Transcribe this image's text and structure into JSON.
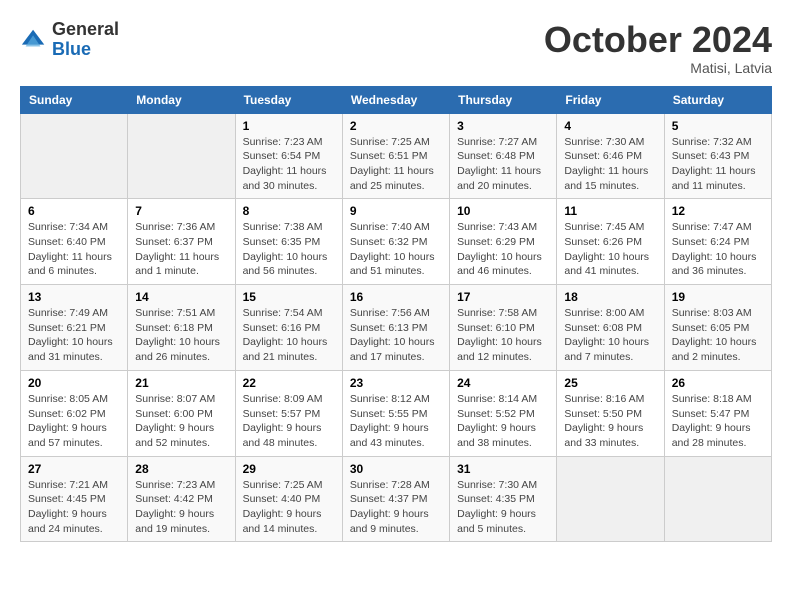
{
  "header": {
    "logo_general": "General",
    "logo_blue": "Blue",
    "month_title": "October 2024",
    "subtitle": "Matisi, Latvia"
  },
  "columns": [
    "Sunday",
    "Monday",
    "Tuesday",
    "Wednesday",
    "Thursday",
    "Friday",
    "Saturday"
  ],
  "weeks": [
    [
      {
        "day": "",
        "info": ""
      },
      {
        "day": "",
        "info": ""
      },
      {
        "day": "1",
        "info": "Sunrise: 7:23 AM\nSunset: 6:54 PM\nDaylight: 11 hours\nand 30 minutes."
      },
      {
        "day": "2",
        "info": "Sunrise: 7:25 AM\nSunset: 6:51 PM\nDaylight: 11 hours\nand 25 minutes."
      },
      {
        "day": "3",
        "info": "Sunrise: 7:27 AM\nSunset: 6:48 PM\nDaylight: 11 hours\nand 20 minutes."
      },
      {
        "day": "4",
        "info": "Sunrise: 7:30 AM\nSunset: 6:46 PM\nDaylight: 11 hours\nand 15 minutes."
      },
      {
        "day": "5",
        "info": "Sunrise: 7:32 AM\nSunset: 6:43 PM\nDaylight: 11 hours\nand 11 minutes."
      }
    ],
    [
      {
        "day": "6",
        "info": "Sunrise: 7:34 AM\nSunset: 6:40 PM\nDaylight: 11 hours\nand 6 minutes."
      },
      {
        "day": "7",
        "info": "Sunrise: 7:36 AM\nSunset: 6:37 PM\nDaylight: 11 hours\nand 1 minute."
      },
      {
        "day": "8",
        "info": "Sunrise: 7:38 AM\nSunset: 6:35 PM\nDaylight: 10 hours\nand 56 minutes."
      },
      {
        "day": "9",
        "info": "Sunrise: 7:40 AM\nSunset: 6:32 PM\nDaylight: 10 hours\nand 51 minutes."
      },
      {
        "day": "10",
        "info": "Sunrise: 7:43 AM\nSunset: 6:29 PM\nDaylight: 10 hours\nand 46 minutes."
      },
      {
        "day": "11",
        "info": "Sunrise: 7:45 AM\nSunset: 6:26 PM\nDaylight: 10 hours\nand 41 minutes."
      },
      {
        "day": "12",
        "info": "Sunrise: 7:47 AM\nSunset: 6:24 PM\nDaylight: 10 hours\nand 36 minutes."
      }
    ],
    [
      {
        "day": "13",
        "info": "Sunrise: 7:49 AM\nSunset: 6:21 PM\nDaylight: 10 hours\nand 31 minutes."
      },
      {
        "day": "14",
        "info": "Sunrise: 7:51 AM\nSunset: 6:18 PM\nDaylight: 10 hours\nand 26 minutes."
      },
      {
        "day": "15",
        "info": "Sunrise: 7:54 AM\nSunset: 6:16 PM\nDaylight: 10 hours\nand 21 minutes."
      },
      {
        "day": "16",
        "info": "Sunrise: 7:56 AM\nSunset: 6:13 PM\nDaylight: 10 hours\nand 17 minutes."
      },
      {
        "day": "17",
        "info": "Sunrise: 7:58 AM\nSunset: 6:10 PM\nDaylight: 10 hours\nand 12 minutes."
      },
      {
        "day": "18",
        "info": "Sunrise: 8:00 AM\nSunset: 6:08 PM\nDaylight: 10 hours\nand 7 minutes."
      },
      {
        "day": "19",
        "info": "Sunrise: 8:03 AM\nSunset: 6:05 PM\nDaylight: 10 hours\nand 2 minutes."
      }
    ],
    [
      {
        "day": "20",
        "info": "Sunrise: 8:05 AM\nSunset: 6:02 PM\nDaylight: 9 hours\nand 57 minutes."
      },
      {
        "day": "21",
        "info": "Sunrise: 8:07 AM\nSunset: 6:00 PM\nDaylight: 9 hours\nand 52 minutes."
      },
      {
        "day": "22",
        "info": "Sunrise: 8:09 AM\nSunset: 5:57 PM\nDaylight: 9 hours\nand 48 minutes."
      },
      {
        "day": "23",
        "info": "Sunrise: 8:12 AM\nSunset: 5:55 PM\nDaylight: 9 hours\nand 43 minutes."
      },
      {
        "day": "24",
        "info": "Sunrise: 8:14 AM\nSunset: 5:52 PM\nDaylight: 9 hours\nand 38 minutes."
      },
      {
        "day": "25",
        "info": "Sunrise: 8:16 AM\nSunset: 5:50 PM\nDaylight: 9 hours\nand 33 minutes."
      },
      {
        "day": "26",
        "info": "Sunrise: 8:18 AM\nSunset: 5:47 PM\nDaylight: 9 hours\nand 28 minutes."
      }
    ],
    [
      {
        "day": "27",
        "info": "Sunrise: 7:21 AM\nSunset: 4:45 PM\nDaylight: 9 hours\nand 24 minutes."
      },
      {
        "day": "28",
        "info": "Sunrise: 7:23 AM\nSunset: 4:42 PM\nDaylight: 9 hours\nand 19 minutes."
      },
      {
        "day": "29",
        "info": "Sunrise: 7:25 AM\nSunset: 4:40 PM\nDaylight: 9 hours\nand 14 minutes."
      },
      {
        "day": "30",
        "info": "Sunrise: 7:28 AM\nSunset: 4:37 PM\nDaylight: 9 hours\nand 9 minutes."
      },
      {
        "day": "31",
        "info": "Sunrise: 7:30 AM\nSunset: 4:35 PM\nDaylight: 9 hours\nand 5 minutes."
      },
      {
        "day": "",
        "info": ""
      },
      {
        "day": "",
        "info": ""
      }
    ]
  ]
}
